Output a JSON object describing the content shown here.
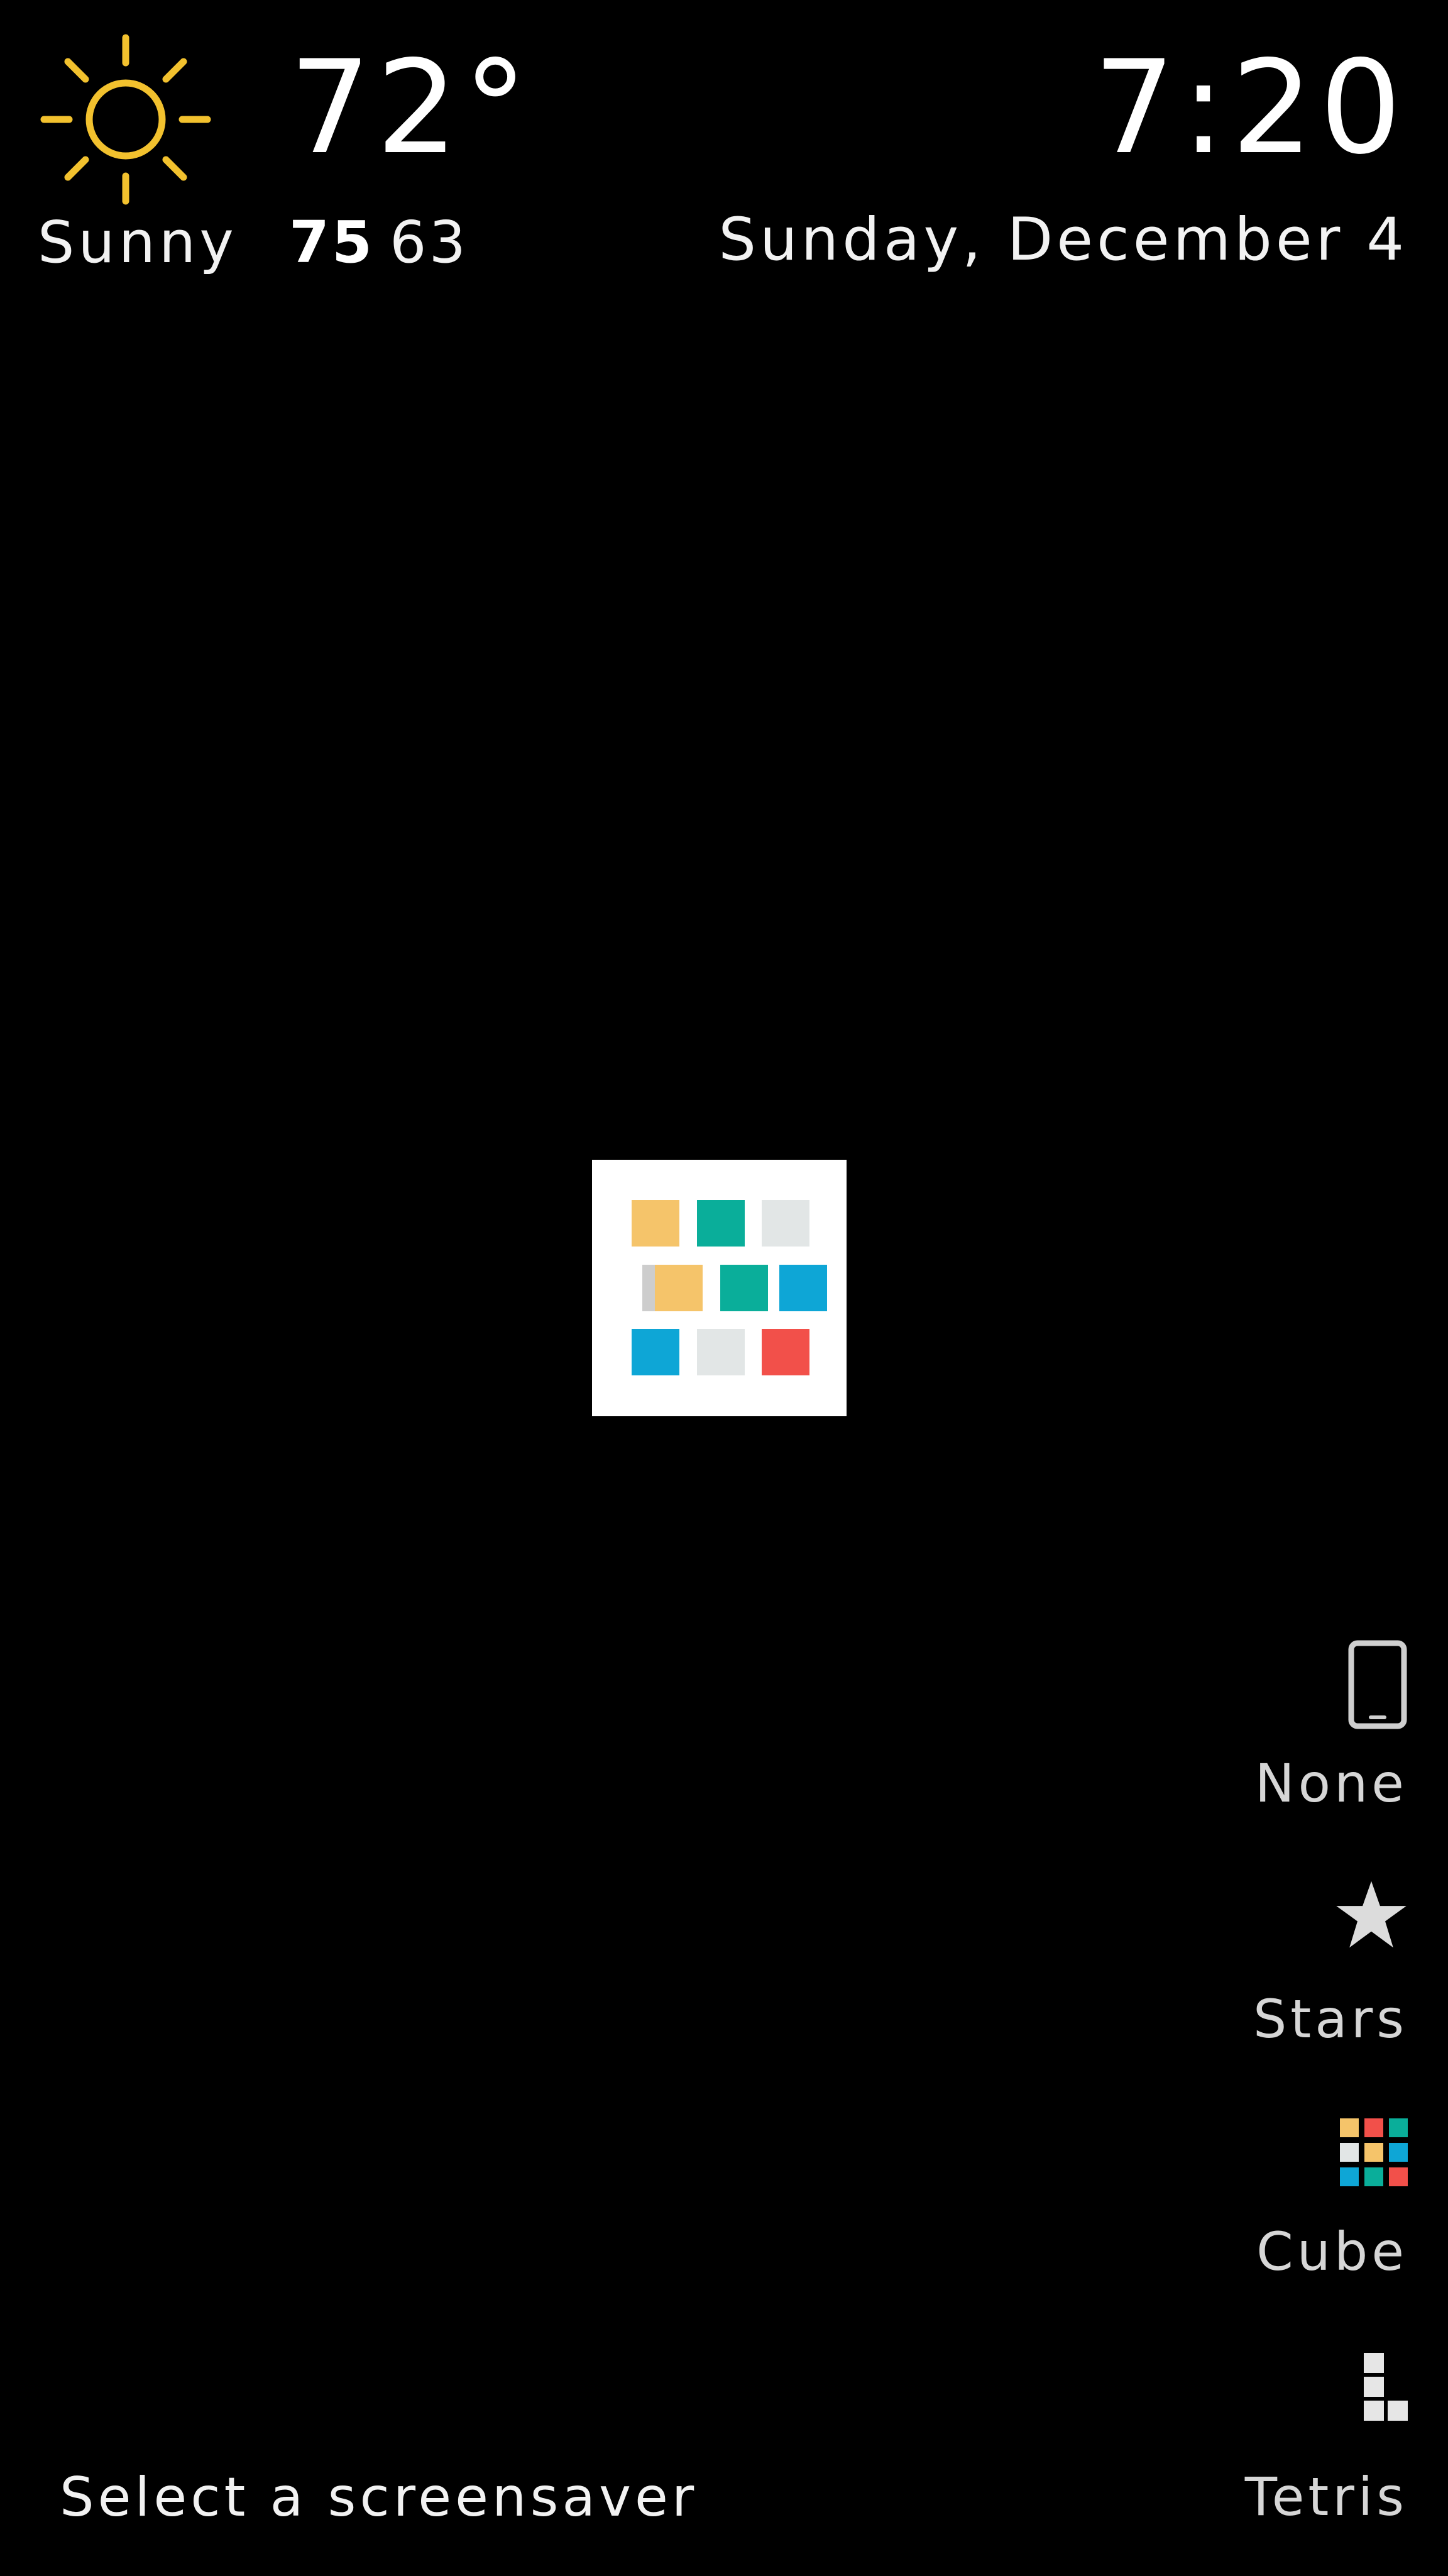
{
  "weather": {
    "icon": "sun-icon",
    "temperature": "72°",
    "condition": "Sunny",
    "high": "75",
    "low": "63",
    "icon_color": "#F2C12E"
  },
  "clock": {
    "time": "7:20",
    "date": "Sunday, December 4"
  },
  "preview": {
    "name": "cube-preview",
    "colors": [
      "#F5C46A",
      "#0AAE9A",
      "#E2E6E6",
      "#0EA6D6",
      "#F2504A"
    ]
  },
  "screensavers": [
    {
      "label": "None",
      "icon": "phone-icon"
    },
    {
      "label": "Stars",
      "icon": "star-icon"
    },
    {
      "label": "Cube",
      "icon": "cube-icon"
    },
    {
      "label": "Tetris",
      "icon": "tetris-icon"
    }
  ],
  "hint": "Select a screensaver"
}
